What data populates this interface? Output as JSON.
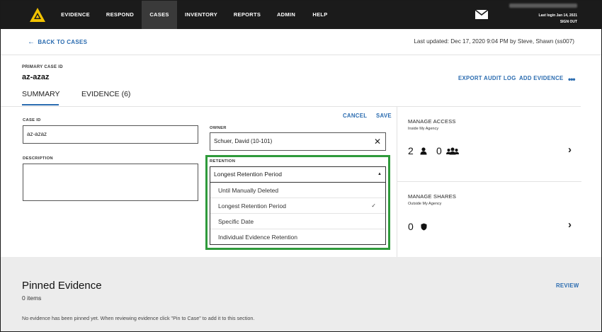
{
  "nav": {
    "items": [
      "EVIDENCE",
      "RESPOND",
      "CASES",
      "INVENTORY",
      "REPORTS",
      "ADMIN",
      "HELP"
    ],
    "active": "CASES",
    "last_login": "Last login Jan 14, 2021",
    "sign_out": "SIGN OUT"
  },
  "subheader": {
    "back_label": "BACK TO CASES",
    "last_updated": "Last updated: Dec 17, 2020 9:04 PM by Steve, Shawn (ss007)"
  },
  "case": {
    "id_label": "PRIMARY CASE ID",
    "title": "az-azaz",
    "export_audit_log": "EXPORT AUDIT LOG",
    "add_evidence": "ADD EVIDENCE"
  },
  "tabs": [
    "SUMMARY",
    "EVIDENCE (6)"
  ],
  "form": {
    "case_id_label": "CASE ID",
    "case_id_value": "az-azaz",
    "description_label": "DESCRIPTION",
    "description_value": "",
    "owner_label": "OWNER",
    "owner_value": "Schuer, David (10-101)",
    "cancel": "CANCEL",
    "save": "SAVE",
    "retention_label": "RETENTION",
    "retention_value": "Longest Retention Period",
    "retention_options": [
      "Until Manually Deleted",
      "Longest Retention Period",
      "Specific Date",
      "Individual Evidence Retention"
    ],
    "retention_selected_index": 1
  },
  "access": {
    "title": "MANAGE ACCESS",
    "subtitle": "Inside My Agency",
    "user_count": "2",
    "group_count": "0"
  },
  "shares": {
    "title": "MANAGE SHARES",
    "subtitle": "Outside My Agency",
    "count": "0"
  },
  "pinned": {
    "title": "Pinned Evidence",
    "count": "0 items",
    "review": "REVIEW",
    "message": "No evidence has been pinned yet. When reviewing evidence click \"Pin to Case\" to add it to this section."
  },
  "colors": {
    "accent": "#2b6cb0",
    "nav_bg": "#1b1b1b",
    "highlight": "#2f9a3b",
    "logo": "#f2c200"
  }
}
